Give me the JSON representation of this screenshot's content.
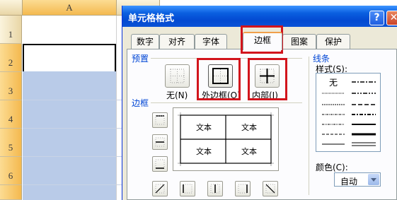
{
  "sheet": {
    "columns": [
      {
        "label": "A"
      },
      {
        "label": ""
      }
    ],
    "rows": [
      "1",
      "2",
      "3",
      "4",
      "5",
      "6"
    ]
  },
  "dialog": {
    "title": "单元格格式",
    "help_label": "?",
    "close_label": "✕",
    "tabs": [
      {
        "label": "数字"
      },
      {
        "label": "对齐"
      },
      {
        "label": "字体"
      },
      {
        "label": "边框",
        "active": true
      },
      {
        "label": "图案"
      },
      {
        "label": "保护"
      }
    ],
    "presets": {
      "group_label": "预置",
      "items": [
        {
          "label": "无(N)",
          "icon": "border-none-icon"
        },
        {
          "label": "外边框(O)",
          "icon": "border-outline-icon"
        },
        {
          "label": "内部(I)",
          "icon": "border-inside-icon"
        }
      ]
    },
    "border": {
      "group_label": "边框",
      "preview_cells": [
        "文本",
        "文本",
        "文本",
        "文本"
      ]
    },
    "line": {
      "group_label": "线条",
      "style_label": "样式(S):",
      "none_label": "无",
      "color_label": "颜色(C):",
      "color_value": "自动"
    },
    "colors": {
      "highlight": "#d2141c",
      "titlebar": "#0a5fe0",
      "group_label": "#0046d5",
      "selection": "#b9cbe8"
    }
  }
}
